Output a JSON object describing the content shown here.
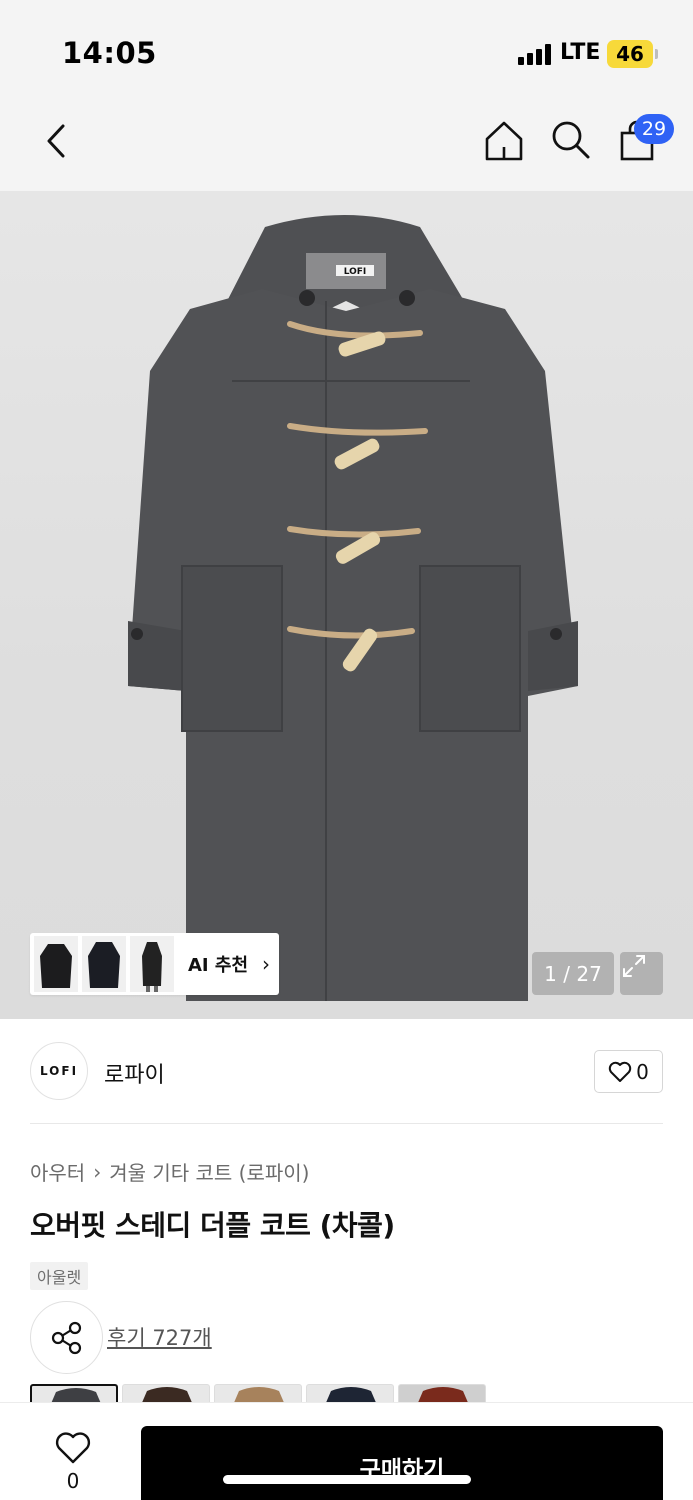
{
  "status_bar": {
    "time": "14:05",
    "network": "LTE",
    "battery": "46"
  },
  "nav": {
    "back_icon": "chevron-left-icon",
    "home_icon": "home-icon",
    "search_icon": "search-icon",
    "cart_icon": "shopping-bag-icon",
    "cart_badge": "29"
  },
  "hero": {
    "brand_label": "LOFI",
    "ai_reco_label": "AI 추천",
    "counter": "1 / 27",
    "expand_icon": "expand-icon"
  },
  "brand": {
    "logo_text": "LOFI",
    "name": "로파이",
    "like_count": "0"
  },
  "product": {
    "breadcrumb": [
      "아우터",
      "겨울 기타 코트 (로파이)"
    ],
    "title": "오버핏 스테디 더플 코트 (차콜)",
    "tag": "아울렛",
    "review_link": "후기 727개"
  },
  "bottom_bar": {
    "like_count": "0",
    "buy_label": "구매하기"
  },
  "colors": {
    "accent_badge": "#2f62f5",
    "battery": "#f7d93a",
    "buy_button": "#000000"
  }
}
